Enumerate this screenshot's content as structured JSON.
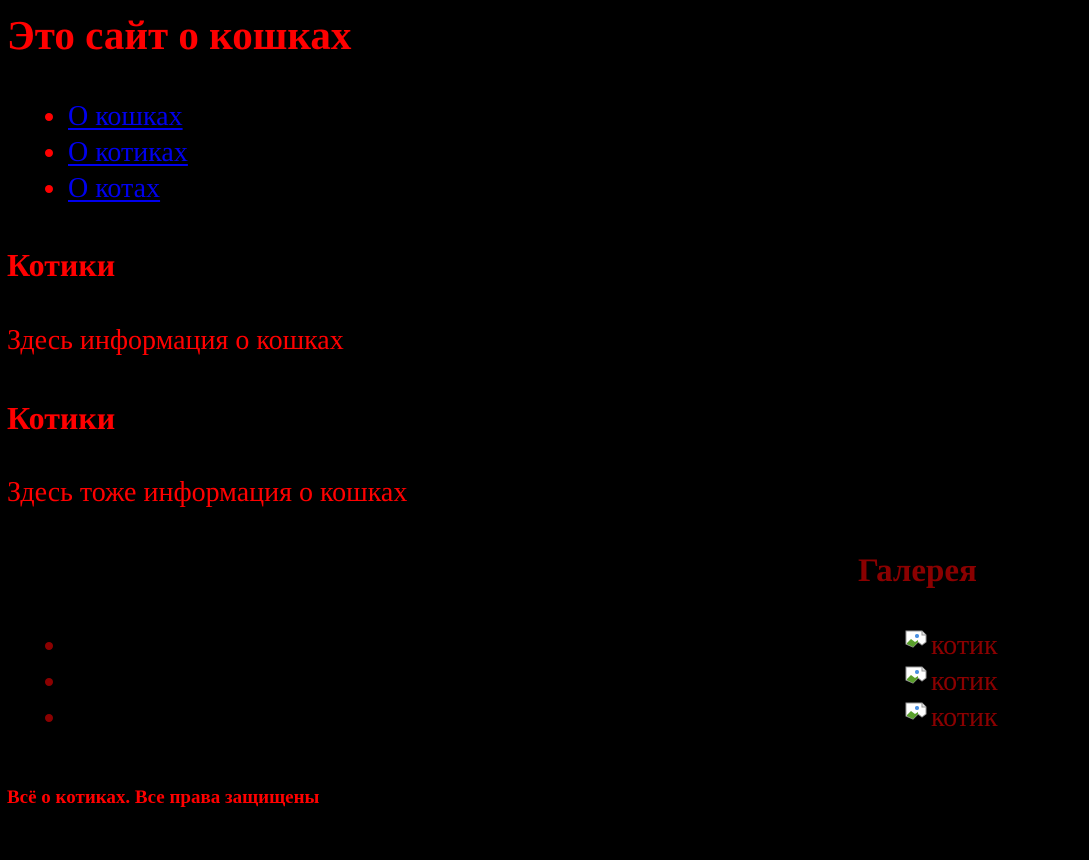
{
  "header": {
    "title": "Это сайт о кошках"
  },
  "nav": {
    "items": [
      {
        "label": "О кошках"
      },
      {
        "label": "О котиках"
      },
      {
        "label": "О котах"
      }
    ]
  },
  "sections": [
    {
      "heading": "Котики",
      "text": "Здесь информация о кошках"
    },
    {
      "heading": "Котики",
      "text": "Здесь тоже информация о кошках"
    }
  ],
  "gallery": {
    "heading": "Галерея",
    "images": [
      {
        "alt": "котик",
        "icon": "broken-image-icon"
      },
      {
        "alt": "котик",
        "icon": "broken-image-icon"
      },
      {
        "alt": "котик",
        "icon": "broken-image-icon"
      }
    ]
  },
  "footer": {
    "text": "Всё о котиках. Все права защищены"
  },
  "colors": {
    "background": "#000000",
    "primary_text": "#ff0000",
    "link": "#0000ee",
    "gallery_text": "#8b0000"
  }
}
